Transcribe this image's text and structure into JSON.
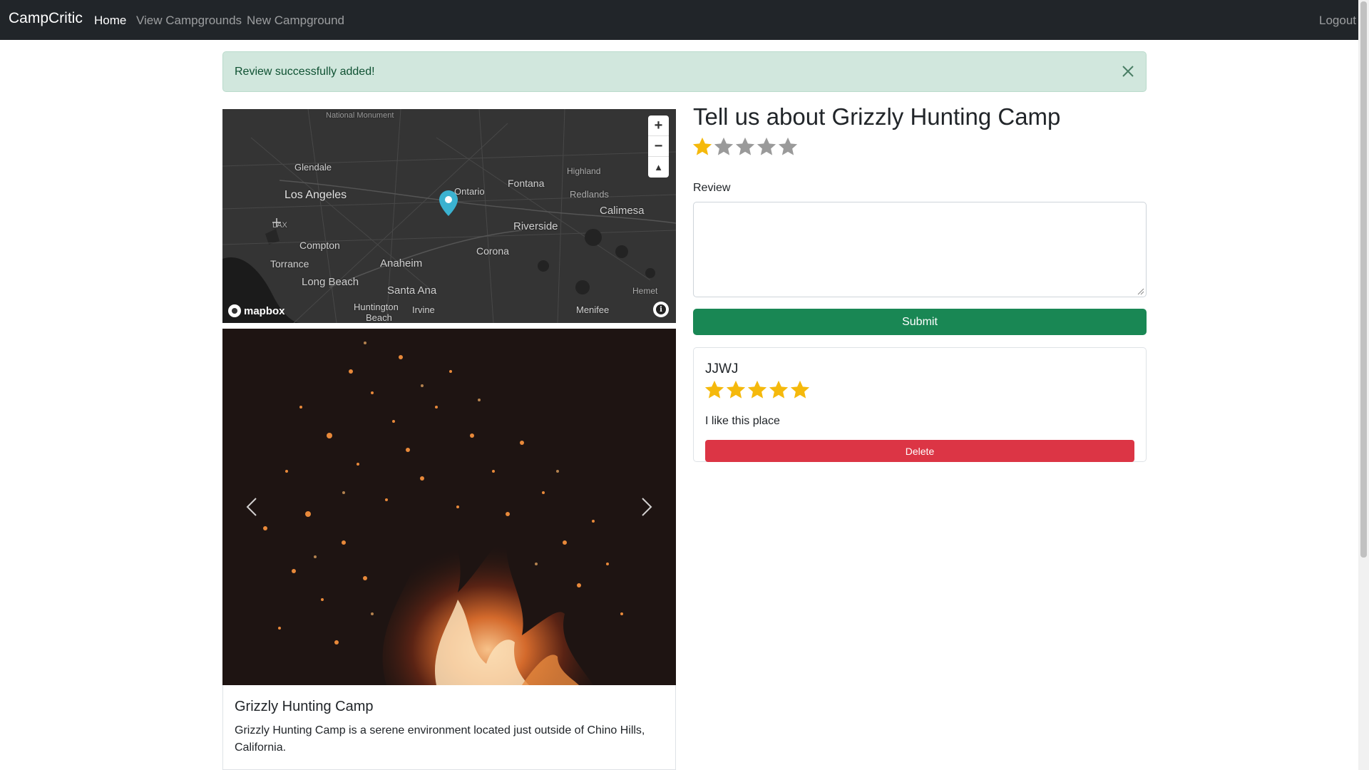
{
  "nav": {
    "brand": "CampCritic",
    "home": "Home",
    "view": "View Campgrounds",
    "new": "New Campground",
    "logout": "Logout"
  },
  "alert": {
    "message": "Review successfully added!"
  },
  "map": {
    "labels": {
      "national_monument": "National Monument",
      "glendale": "Glendale",
      "los_angeles": "Los Angeles",
      "ontario": "Ontario",
      "fontana": "Fontana",
      "highland": "Highland",
      "redlands": "Redlands",
      "calimesa": "Calimesa",
      "lax": "LAX",
      "compton": "Compton",
      "riverside": "Riverside",
      "corona": "Corona",
      "torrance": "Torrance",
      "anaheim": "Anaheim",
      "long_beach": "Long Beach",
      "santa_ana": "Santa Ana",
      "hemet": "Hemet",
      "huntington": "Huntington",
      "beach": "Beach",
      "irvine": "Irvine",
      "menifee": "Menifee"
    },
    "zoom_in": "+",
    "zoom_out": "−",
    "compass": "▲",
    "logo": "mapbox",
    "info": "i"
  },
  "campground": {
    "title": "Grizzly Hunting Camp",
    "description": "Grizzly Hunting Camp is a serene environment located just outside of Chino Hills, California."
  },
  "form": {
    "heading": "Tell us about Grizzly Hunting Camp",
    "rating": 1,
    "review_label": "Review",
    "review_value": "",
    "submit": "Submit"
  },
  "reviews": [
    {
      "author": "JJWJ",
      "rating": 5,
      "text": "I like this place",
      "delete": "Delete"
    }
  ],
  "colors": {
    "star_filled": "#f5b90c",
    "star_empty": "#9a9a9a",
    "success": "#198754",
    "danger": "#dc3545",
    "map_pin": "#3bb2d0"
  }
}
